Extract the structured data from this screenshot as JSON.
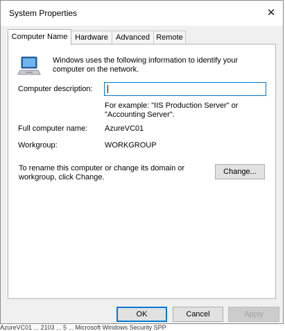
{
  "window": {
    "title": "System Properties"
  },
  "tabs": [
    {
      "label": "Computer Name",
      "active": true
    },
    {
      "label": "Hardware",
      "active": false
    },
    {
      "label": "Advanced",
      "active": false
    },
    {
      "label": "Remote",
      "active": false
    }
  ],
  "main": {
    "intro": "Windows uses the following information to identify your computer on the network.",
    "description_label": "Computer description:",
    "description_value": "",
    "example": "For example: \"IIS Production Server\" or \"Accounting Server\".",
    "full_name_label": "Full computer name:",
    "full_name_value": "AzureVC01",
    "workgroup_label": "Workgroup:",
    "workgroup_value": "WORKGROUP",
    "rename_text": "To rename this computer or change its domain or workgroup, click Change.",
    "change_button": "Change..."
  },
  "footer": {
    "ok": "OK",
    "cancel": "Cancel",
    "apply": "Apply"
  },
  "colors": {
    "accent": "#0078d7",
    "dialog_bg": "#f0f0f0",
    "panel_bg": "#ffffff"
  },
  "icons": {
    "close": "close-icon",
    "computer": "computer-network-icon"
  },
  "background_strip": "AzureVC01 ... 2103 ... 5 ... Microsoft Windows Security SPP"
}
